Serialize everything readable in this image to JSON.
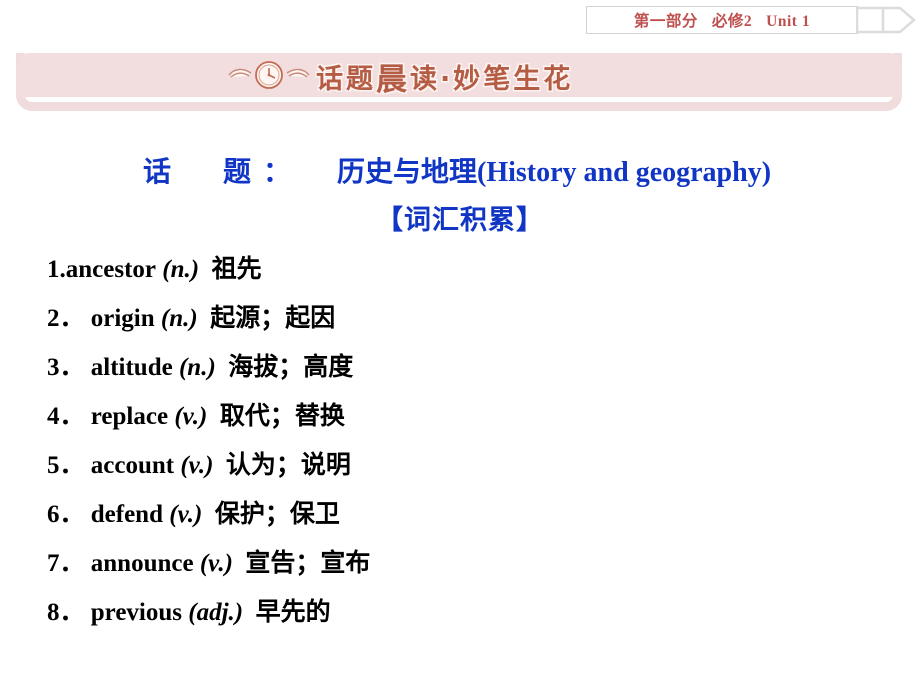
{
  "header": {
    "part": "第一部分",
    "book": "必修2",
    "unit": "Unit 1",
    "chevron_icon": "double-chevron-right-icon",
    "accent_color": "#bf5050"
  },
  "banner": {
    "icon": "winged-clock-icon",
    "title_prefix": "话题",
    "title_emphasis": "晨",
    "title_middle": "读·妙",
    "title_suffix": "笔生花",
    "title_full": "话题晨 读·妙笔生花",
    "background_color": "#f2dede",
    "frame_color": "#f0dcdc",
    "text_color": "#b55c44"
  },
  "content": {
    "topic_label": "话　题：",
    "topic_spacer": "　",
    "topic_value": "历史与地理(History and geography)",
    "subtitle": "【词汇积累】",
    "accent_color": "#1135c4",
    "vocabulary": [
      {
        "num": "1.",
        "word": "ancestor",
        "pos": "(n.)",
        "meaning": "祖先"
      },
      {
        "num": "2．",
        "word": "origin",
        "pos": "(n.)",
        "meaning": "起源；起因"
      },
      {
        "num": "3．",
        "word": "altitude",
        "pos": "(n.)",
        "meaning": "海拔；高度"
      },
      {
        "num": "4．",
        "word": "replace",
        "pos": "(v.)",
        "meaning": "取代；替换"
      },
      {
        "num": "5．",
        "word": "account",
        "pos": "(v.)",
        "meaning": "认为；说明"
      },
      {
        "num": "6．",
        "word": "defend",
        "pos": "(v.)",
        "meaning": "保护；保卫"
      },
      {
        "num": "7．",
        "word": "announce",
        "pos": "(v.)",
        "meaning": "宣告；宣布"
      },
      {
        "num": "8．",
        "word": "previous",
        "pos": "(adj.)",
        "meaning": "早先的"
      }
    ]
  }
}
